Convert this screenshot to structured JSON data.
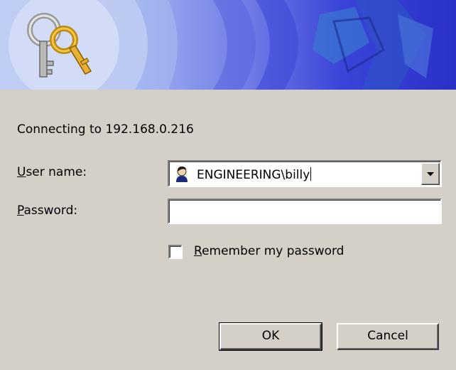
{
  "dialog": {
    "connecting_text": "Connecting to 192.168.0.216",
    "username_label_key": "U",
    "username_label_rest": "ser name:",
    "password_label_key": "P",
    "password_label_rest": "assword:",
    "username_value": "ENGINEERING\\billy",
    "password_value": "",
    "remember_key": "R",
    "remember_rest": "emember my password",
    "remember_checked": false,
    "ok_label": "OK",
    "cancel_label": "Cancel"
  },
  "icons": {
    "banner": "keys-icon",
    "user": "user-icon",
    "dropdown": "chevron-down-icon"
  },
  "colors": {
    "dialog_bg": "#d4d0c8",
    "banner_light": "#b8c8f0",
    "banner_dark": "#2a30c8"
  }
}
